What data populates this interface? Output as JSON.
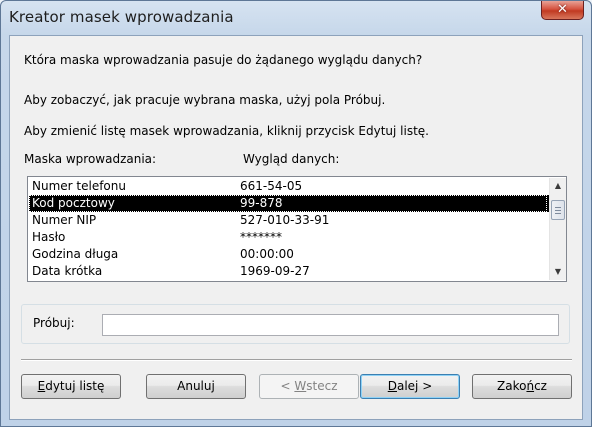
{
  "window": {
    "title": "Kreator masek wprowadzania",
    "close_glyph": "✕"
  },
  "intro": {
    "question": "Która maska wprowadzania pasuje do żądanego wyglądu danych?",
    "hint1": "Aby zobaczyć, jak pracuje wybrana maska, użyj pola Próbuj.",
    "hint2": "Aby zmienić listę masek wprowadzania, kliknij przycisk Edytuj listę."
  },
  "list": {
    "col1_header": "Maska wprowadzania:",
    "col2_header": "Wygląd danych:",
    "selected_index": 1,
    "rows": [
      {
        "mask": "Numer telefonu",
        "look": "661-54-05"
      },
      {
        "mask": "Kod pocztowy",
        "look": "99-878"
      },
      {
        "mask": "Numer NIP",
        "look": "527-010-33-91"
      },
      {
        "mask": "Hasło",
        "look": "*******"
      },
      {
        "mask": "Godzina długa",
        "look": "00:00:00"
      },
      {
        "mask": "Data krótka",
        "look": "1969-09-27"
      }
    ],
    "scroll_up_icon": "▲",
    "scroll_down_icon": "▼"
  },
  "try": {
    "label": "Próbuj:",
    "value": ""
  },
  "buttons": {
    "edit_list": {
      "pre": "",
      "key": "E",
      "post": "dytuj listę"
    },
    "cancel": {
      "label": "Anuluj"
    },
    "back": {
      "pre": "< ",
      "key": "W",
      "post": "stecz"
    },
    "next": {
      "pre": "",
      "key": "D",
      "post": "alej >"
    },
    "finish": {
      "pre": "Zako",
      "key": "ń",
      "post": "cz"
    }
  }
}
